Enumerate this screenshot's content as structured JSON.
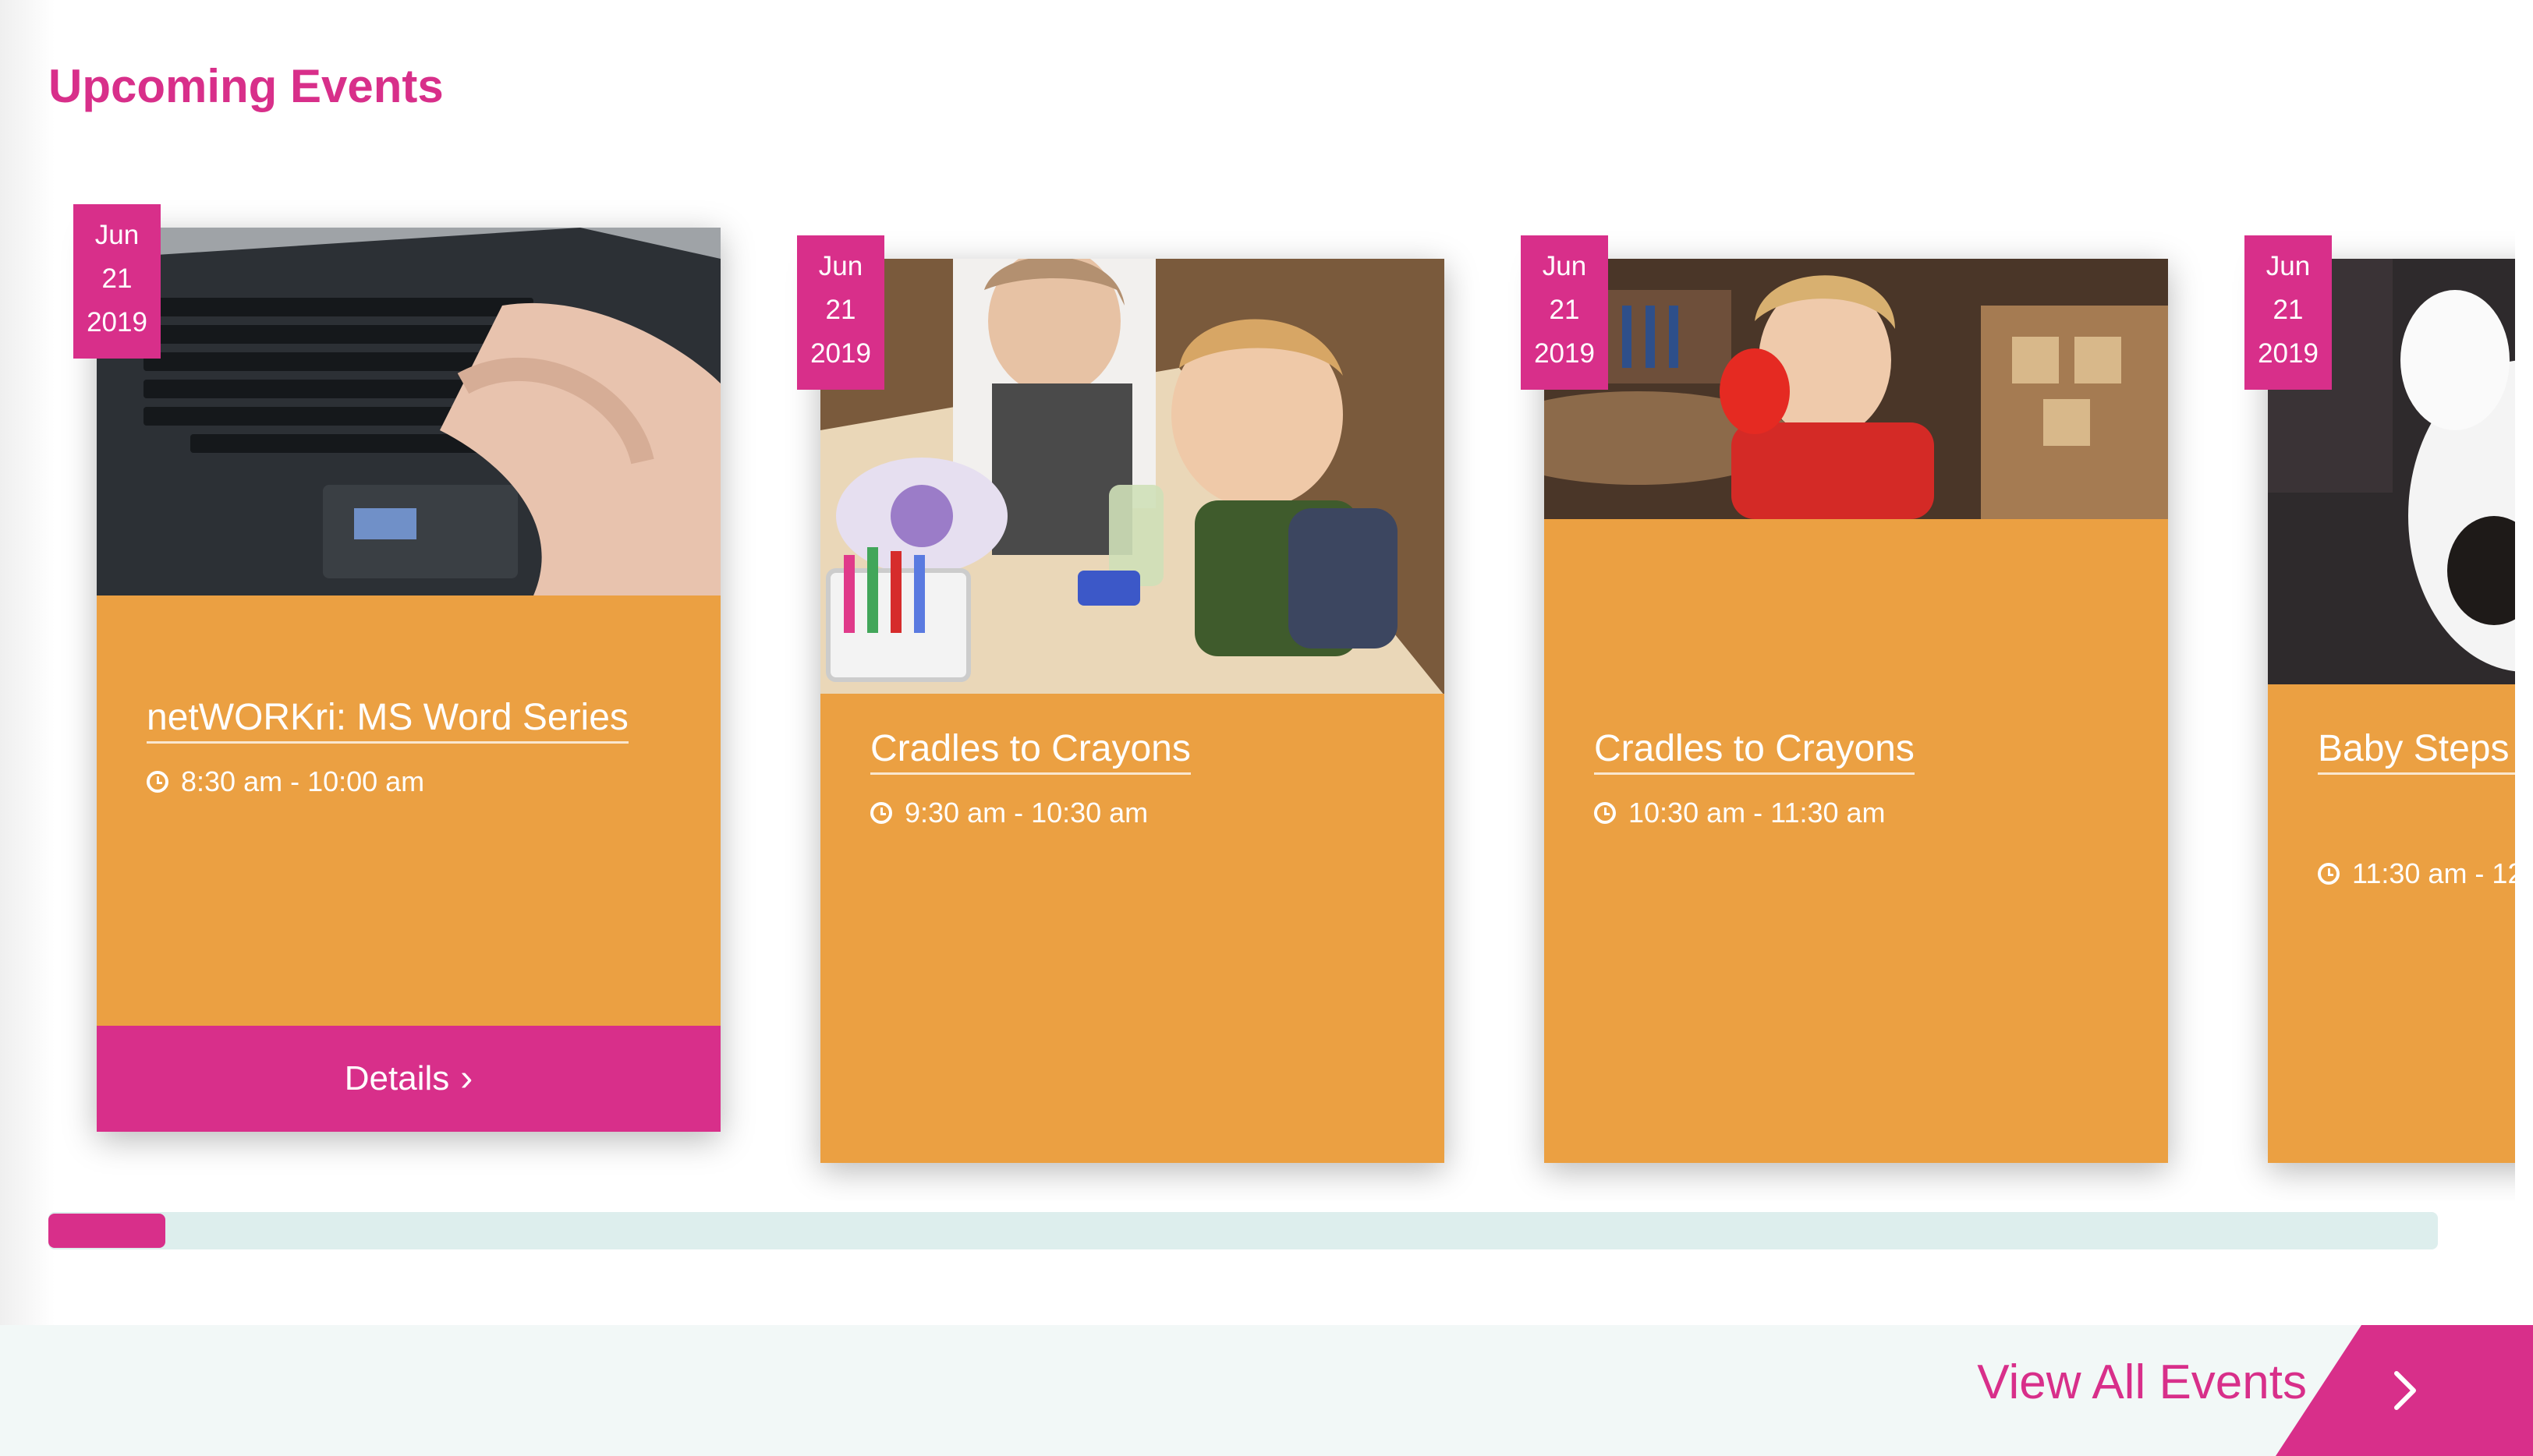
{
  "section": {
    "title": "Upcoming Events"
  },
  "events": [
    {
      "month": "Jun",
      "day": "21",
      "year": "2019",
      "title": "netWORKri: MS Word Series",
      "time": "8:30 am - 10:00 am",
      "details_label": "Details"
    },
    {
      "month": "Jun",
      "day": "21",
      "year": "2019",
      "title": "Cradles to Crayons",
      "time": "9:30 am - 10:30 am"
    },
    {
      "month": "Jun",
      "day": "21",
      "year": "2019",
      "title": "Cradles to Crayons",
      "time": "10:30 am - 11:30 am"
    },
    {
      "month": "Jun",
      "day": "21",
      "year": "2019",
      "title": "Baby Steps Story Time",
      "time": "11:30 am - 12"
    }
  ],
  "carousel": {
    "scroll_position": 0.05
  },
  "footer": {
    "view_all_label": "View All Events"
  },
  "icons": {
    "time": "clock-icon",
    "details": "chevron-right-icon",
    "view_all": "chevron-right-icon"
  },
  "colors": {
    "accent": "#d82f8a",
    "card": "#eba042",
    "scroll_track": "#ddeeed",
    "footer_bg": "#f2f8f7"
  }
}
